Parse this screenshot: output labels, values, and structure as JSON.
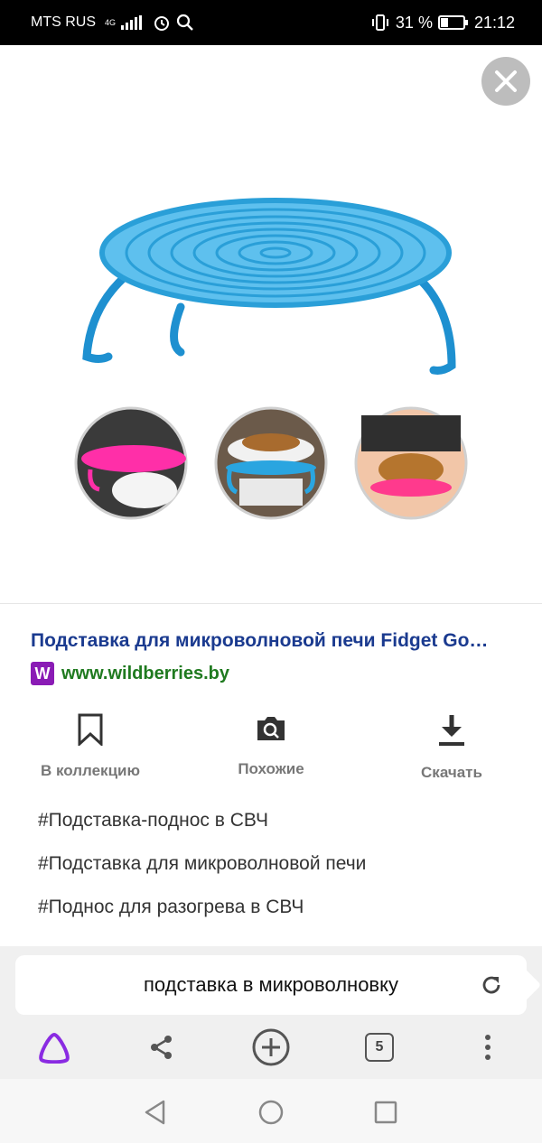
{
  "status_bar": {
    "carrier": "MTS RUS",
    "network": "4G",
    "battery": "31 %",
    "time": "21:12"
  },
  "viewer": {
    "close_icon": "close-icon",
    "image_subject": "product-photo"
  },
  "result": {
    "title": "Подставка для микроволновой печи Fidget Go…",
    "favicon_letter": "W",
    "site": "www.wildberries.by"
  },
  "actions": [
    {
      "label": "В коллекцию",
      "icon": "bookmark-icon"
    },
    {
      "label": "Похожие",
      "icon": "camera-search-icon"
    },
    {
      "label": "Скачать",
      "icon": "download-icon"
    }
  ],
  "tags": [
    "#Подставка-поднос в СВЧ",
    "#Подставка для микроволновой печи",
    "#Поднос для разогрева в СВЧ"
  ],
  "search": {
    "query": "подставка в микроволновку"
  },
  "toolbar": {
    "tabs_count": "5"
  },
  "colors": {
    "link_title": "#1a3a8f",
    "site_url": "#1f7a1f",
    "favicon": "#8a1bb5",
    "assistant": "#8a2be2",
    "product_blue": "#2a9fd8"
  }
}
